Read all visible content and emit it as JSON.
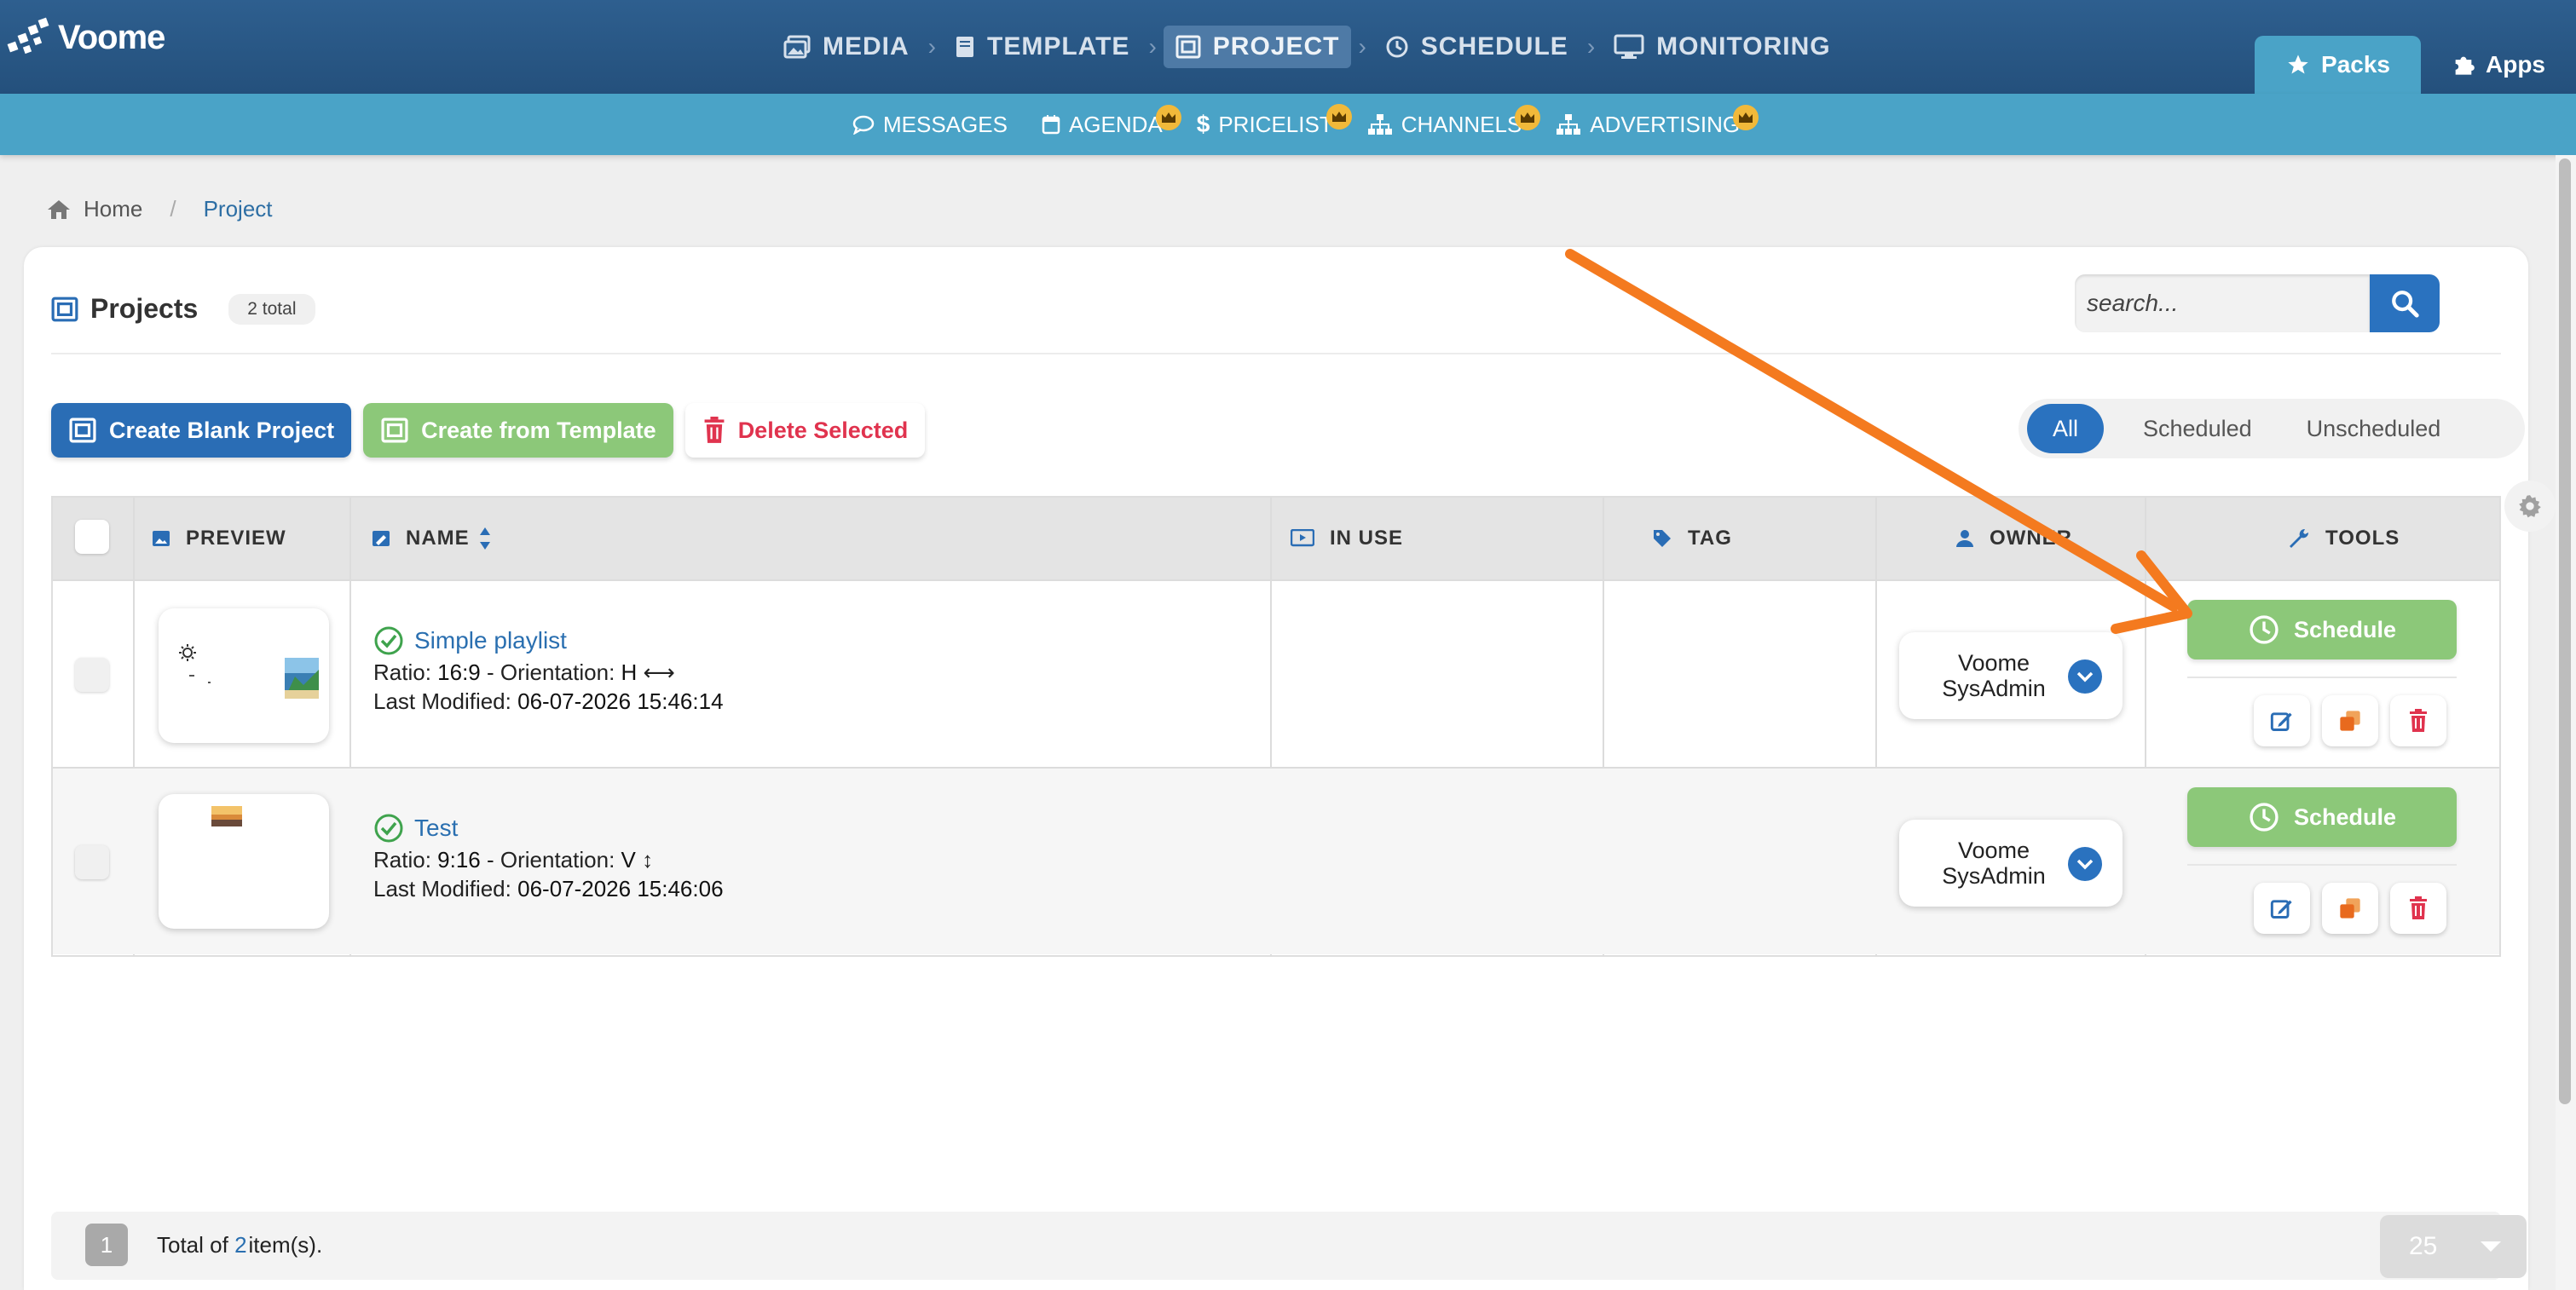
{
  "app": {
    "name": "Voome"
  },
  "main_nav": [
    {
      "label": "MEDIA",
      "icon": "image-icon",
      "active": false
    },
    {
      "label": "TEMPLATE",
      "icon": "book-icon",
      "active": false
    },
    {
      "label": "PROJECT",
      "icon": "project-icon",
      "active": true
    },
    {
      "label": "SCHEDULE",
      "icon": "clock-icon",
      "active": false
    },
    {
      "label": "MONITORING",
      "icon": "monitor-icon",
      "active": false
    }
  ],
  "right_tabs": [
    {
      "label": "Packs",
      "icon": "star-icon",
      "active": true
    },
    {
      "label": "Apps",
      "icon": "puzzle-icon",
      "active": false
    }
  ],
  "sub_nav": [
    {
      "label": "MESSAGES",
      "icon": "chat-icon",
      "premium": false
    },
    {
      "label": "AGENDA",
      "icon": "calendar-icon",
      "premium": true
    },
    {
      "label": "PRICELIST",
      "icon": "dollar-icon",
      "premium": true
    },
    {
      "label": "CHANNELS",
      "icon": "sitemap-icon",
      "premium": true
    },
    {
      "label": "ADVERTISING",
      "icon": "sitemap-icon",
      "premium": true
    }
  ],
  "breadcrumb": {
    "home": "Home",
    "current": "Project"
  },
  "projects": {
    "title": "Projects",
    "count_badge": "2 total",
    "search": {
      "placeholder": "search..."
    },
    "buttons": {
      "create_blank": "Create Blank Project",
      "create_template": "Create from Template",
      "delete_selected": "Delete Selected"
    },
    "filters": [
      {
        "label": "All",
        "active": true
      },
      {
        "label": "Scheduled",
        "active": false
      },
      {
        "label": "Unscheduled",
        "active": false
      }
    ],
    "columns": {
      "preview": "PREVIEW",
      "name": "NAME",
      "in_use": "IN USE",
      "tag": "TAG",
      "owner": "OWNER",
      "tools": "TOOLS"
    },
    "labels": {
      "ratio": "Ratio:",
      "orientation": "- Orientation:",
      "last_modified": "Last Modified:",
      "schedule": "Schedule"
    },
    "rows": [
      {
        "name": "Simple playlist",
        "ratio": "16:9",
        "orientation": "H",
        "last_modified": "06-07-2026 15:46:14",
        "owner_line1": "Voome",
        "owner_line2": "SysAdmin"
      },
      {
        "name": "Test",
        "ratio": "9:16",
        "orientation": "V",
        "last_modified": "06-07-2026 15:46:06",
        "owner_line1": "Voome",
        "owner_line2": "SysAdmin"
      }
    ],
    "footer": {
      "page": "1",
      "total_prefix": "Total of",
      "total_count": "2",
      "total_suffix": "item(s).",
      "page_size": "25"
    }
  },
  "colors": {
    "header": "#2a5886",
    "subbar": "#4aa3c7",
    "primary": "#2a72bf",
    "success": "#8cc879",
    "danger": "#e0334e",
    "crown": "#f1b93a",
    "annotation_arrow": "#f47a1f"
  }
}
